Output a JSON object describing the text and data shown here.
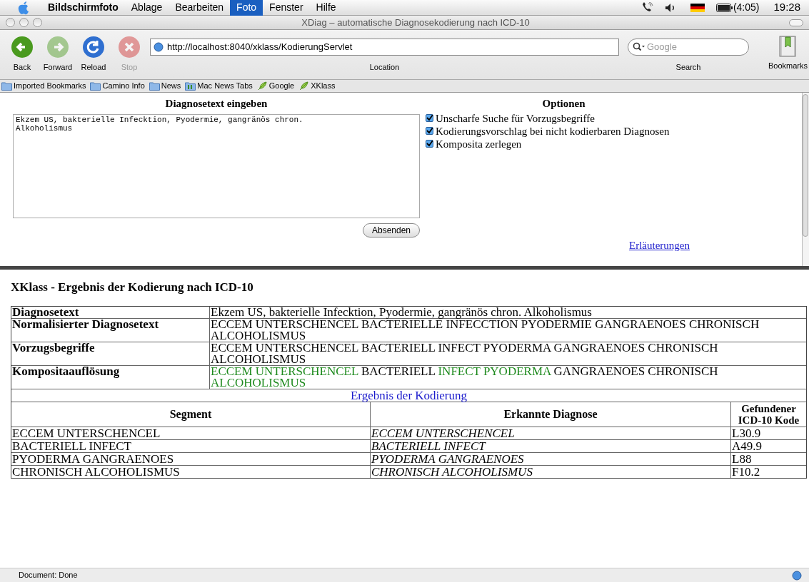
{
  "menu_bar": {
    "items": [
      {
        "label": "Bildschirmfoto",
        "selected": false,
        "kind": "app"
      },
      {
        "label": "Ablage",
        "selected": false,
        "kind": "menu"
      },
      {
        "label": "Bearbeiten",
        "selected": false,
        "kind": "menu"
      },
      {
        "label": "Foto",
        "selected": true,
        "kind": "menu"
      },
      {
        "label": "Fenster",
        "selected": false,
        "kind": "menu"
      },
      {
        "label": "Hilfe",
        "selected": false,
        "kind": "menu"
      }
    ],
    "battery_time": "(4:05)",
    "clock": "19:28"
  },
  "window": {
    "title": "XDiag – automatische Diagnosekodierung nach ICD-10"
  },
  "toolbar": {
    "buttons": [
      {
        "label": "Back",
        "kind": "back",
        "disabled": false
      },
      {
        "label": "Forward",
        "kind": "forward",
        "disabled": false
      },
      {
        "label": "Reload",
        "kind": "reload",
        "disabled": false
      },
      {
        "label": "Stop",
        "kind": "stop",
        "disabled": true
      }
    ],
    "location": {
      "url": "http://localhost:8040/xklass/KodierungServlet",
      "label": "Location"
    },
    "search": {
      "placeholder": "Google",
      "label": "Search"
    },
    "bookmarks": {
      "label": "Bookmarks"
    }
  },
  "bookmarks_bar": [
    {
      "label": "Imported Bookmarks",
      "kind": "folder"
    },
    {
      "label": "Camino Info",
      "kind": "folder"
    },
    {
      "label": "News",
      "kind": "folder"
    },
    {
      "label": "Mac News Tabs",
      "kind": "tabs"
    },
    {
      "label": "Google",
      "kind": "link"
    },
    {
      "label": "XKlass",
      "kind": "link"
    }
  ],
  "form": {
    "heading": "Diagnosetext eingeben",
    "text": "Ekzem US, bakterielle Infecktion, Pyodermie, gangränös chron.\nAlkoholismus",
    "submit": "Absenden",
    "options_heading": "Optionen",
    "options": [
      {
        "label": "Unscharfe Suche für Vorzugsbegriffe",
        "checked": true
      },
      {
        "label": "Kodierungsvorschlag bei nicht kodierbaren Diagnosen",
        "checked": true
      },
      {
        "label": "Komposita zerlegen",
        "checked": true
      }
    ],
    "link": "Erläuterungen"
  },
  "result": {
    "title": "XKlass - Ergebnis der Kodierung nach ICD-10",
    "summary": [
      {
        "label": "Diagnosetext",
        "segments": [
          {
            "text": "Ekzem US, bakterielle Infecktion, Pyodermie, gangränös chron. Alkoholismus",
            "highlighted": false
          }
        ]
      },
      {
        "label": "Normalisierter Diagnosetext",
        "segments": [
          {
            "text": "ECCEM UNTERSCHENCEL BACTERIELLE INFECCTION PYODERMIE GANGRAENOES CHRONISCH ALCOHOLISMUS",
            "highlighted": false
          }
        ]
      },
      {
        "label": "Vorzugsbegriffe",
        "segments": [
          {
            "text": "ECCEM UNTERSCHENCEL BACTERIELL INFECT PYODERMA GANGRAENOES CHRONISCH ALCOHOLISMUS",
            "highlighted": false
          }
        ]
      },
      {
        "label": "Kompositaauflösung",
        "segments": [
          {
            "text": "ECCEM UNTERSCHENCEL",
            "highlighted": true
          },
          {
            "text": "BACTERIELL",
            "highlighted": false
          },
          {
            "text": "INFECT PYODERMA",
            "highlighted": true
          },
          {
            "text": "GANGRAENOES CHRONISCH",
            "highlighted": false
          },
          {
            "text": "ALCOHOLISMUS",
            "highlighted": true
          }
        ]
      }
    ],
    "caption": "Ergebnis der Kodierung",
    "columns": [
      "Segment",
      "Erkannte Diagnose",
      "Gefundener ICD-10 Kode"
    ],
    "rows": [
      [
        "ECCEM UNTERSCHENCEL",
        "ECCEM UNTERSCHENCEL",
        "L30.9"
      ],
      [
        "BACTERIELL INFECT",
        "BACTERIELL INFECT",
        "A49.9"
      ],
      [
        "PYODERMA GANGRAENOES",
        "PYODERMA GANGRAENOES",
        "L88"
      ],
      [
        "CHRONISCH ALCOHOLISMUS",
        "CHRONISCH ALCOHOLISMUS",
        "F10.2"
      ]
    ]
  },
  "status_bar": {
    "text": "Document: Done"
  }
}
